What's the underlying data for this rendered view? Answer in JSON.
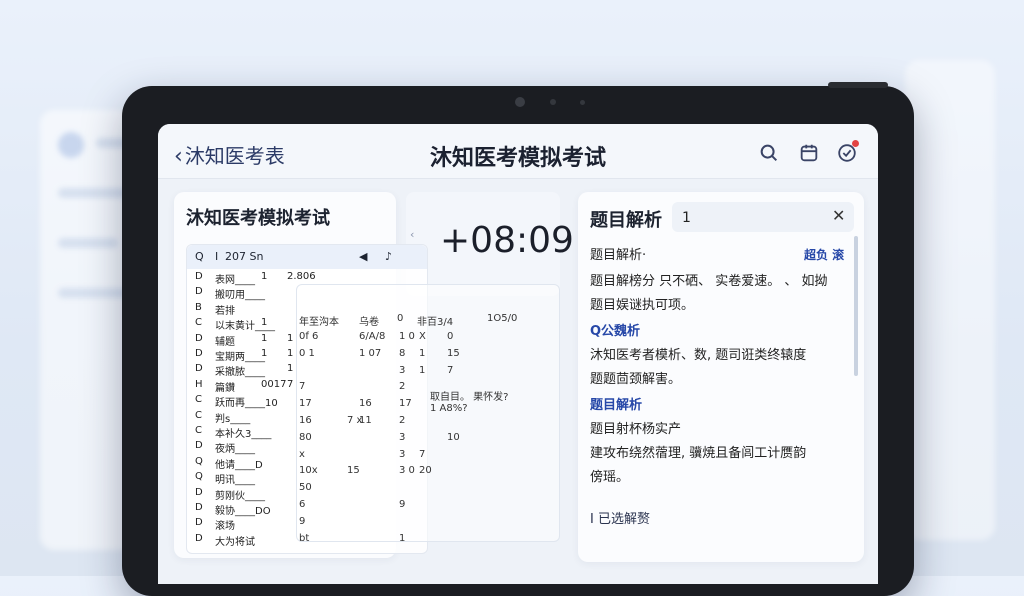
{
  "header": {
    "back_label": "沐知医考表",
    "title": "沐知医考模拟考试"
  },
  "left_panel": {
    "title": "沐知医考模拟考试",
    "table_header": [
      "Q",
      "I",
      "207 Sn",
      "",
      ""
    ],
    "rows": [
      {
        "c0": "D",
        "c1": "表网____",
        "c2": "1",
        "c3": "2.806"
      },
      {
        "c0": "D",
        "c1": "搬叨用____",
        "c2": "",
        "c3": ""
      },
      {
        "c0": "B",
        "c1": "若排",
        "c2": "",
        "c3": ""
      },
      {
        "c0": "C",
        "c1": "以末黄计____",
        "c2": "1",
        "c3": ""
      },
      {
        "c0": "D",
        "c1": "辅题",
        "c2": "1",
        "c3": "1"
      },
      {
        "c0": "D",
        "c1": "宝期两____",
        "c2": "1",
        "c3": "1"
      },
      {
        "c0": "D",
        "c1": "采撤脓____",
        "c2": "",
        "c3": "1"
      },
      {
        "c0": "H",
        "c1": "篇鑽",
        "c2": "0017",
        "c3": "7"
      },
      {
        "c0": "C",
        "c1": "跃而再____10",
        "c2": "",
        "c3": ""
      },
      {
        "c0": "C",
        "c1": "判s____",
        "c2": "",
        "c3": ""
      },
      {
        "c0": "C",
        "c1": "本补久3____",
        "c2": "",
        "c3": ""
      },
      {
        "c0": "D",
        "c1": "夜炳____",
        "c2": "",
        "c3": ""
      },
      {
        "c0": "Q",
        "c1": "他请____D",
        "c2": "",
        "c3": ""
      },
      {
        "c0": "Q",
        "c1": "明讯____",
        "c2": "",
        "c3": ""
      },
      {
        "c0": "D",
        "c1": "剪刚伙____",
        "c2": "",
        "c3": ""
      },
      {
        "c0": "D",
        "c1": "毅协____DO",
        "c2": "",
        "c3": ""
      },
      {
        "c0": "D",
        "c1": "滚场",
        "c2": "",
        "c3": ""
      },
      {
        "c0": "D",
        "c1": "大为将试",
        "c2": "",
        "c3": ""
      }
    ]
  },
  "middle_panel": {
    "header": [
      "年至沟本",
      "乌卷",
      "0",
      "非百3/4",
      "1O5/0"
    ],
    "rows": [
      [
        "0f 6",
        "",
        "6/A/8",
        "1 0",
        "X",
        "0"
      ],
      [
        "0 1",
        "",
        "1 07",
        "8",
        "1",
        "15"
      ],
      [
        "",
        "",
        "",
        "3",
        "1",
        "7"
      ],
      [
        "7",
        "",
        "",
        "2",
        "",
        ""
      ],
      [
        "17",
        "",
        "16",
        "17",
        "",
        ""
      ],
      [
        "16",
        "7 x",
        "11",
        "2",
        "",
        ""
      ],
      [
        "80",
        "",
        "",
        "3",
        "",
        "10"
      ],
      [
        "x",
        "",
        "",
        "3",
        "7",
        ""
      ],
      [
        "10x",
        "15",
        "",
        "3 0",
        "20",
        ""
      ],
      [
        "50",
        "",
        "",
        "",
        "",
        ""
      ],
      [
        "6",
        "",
        "",
        "9",
        "",
        ""
      ],
      [
        "9",
        "",
        "",
        "",
        "",
        ""
      ],
      [
        "bt",
        "",
        "",
        "1",
        "",
        ""
      ]
    ],
    "question_text": "取自目。 果怀发?",
    "question_text2": "1 A8%?"
  },
  "timer": {
    "value": "08:09",
    "prefix": "+"
  },
  "right_panel": {
    "title": "题目解析",
    "search_value": "1",
    "link_label": "超负 滚",
    "lines": [
      {
        "type": "text",
        "value": "题目解析·"
      },
      {
        "type": "text",
        "value": "题目解榜分 只不硒、 实卷爱速。 、 如拗"
      },
      {
        "type": "text",
        "value": "题目娱谜执可项。"
      },
      {
        "type": "head",
        "value": "Q公魏析"
      },
      {
        "type": "text",
        "value": "沐知医考者模析、数, 题司诳类终辕度"
      },
      {
        "type": "text",
        "value": "题题茴颈解害。"
      },
      {
        "type": "head",
        "value": "题目解析"
      },
      {
        "type": "text",
        "value": "题目射杯杨实产"
      },
      {
        "type": "text",
        "value": "建攻布绕然蓿理, 骥焼且备闾工计赝韵"
      },
      {
        "type": "text",
        "value": "傍瑶。"
      }
    ],
    "bottom_label": "I 已选解赘"
  },
  "colors": {
    "accent": "#2748a8",
    "notification": "#e24343"
  }
}
